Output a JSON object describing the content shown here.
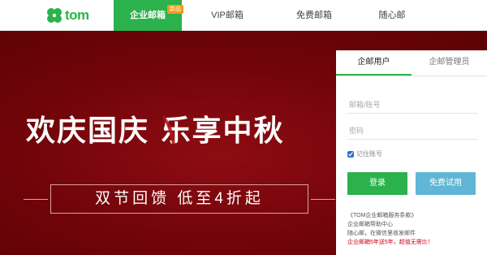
{
  "brand": {
    "logo_text": "tom",
    "logo_color": "#2bb24c"
  },
  "nav": {
    "items": [
      {
        "label": "企业邮箱",
        "active": true,
        "badge": "新品"
      },
      {
        "label": "VIP邮箱"
      },
      {
        "label": "免费邮箱"
      },
      {
        "label": "随心邮"
      }
    ]
  },
  "hero": {
    "line1": "欢庆国庆 乐享中秋",
    "line2": "双节回馈 低至4折起",
    "background": "#7a070c"
  },
  "login": {
    "tabs": [
      {
        "label": "企邮用户",
        "active": true
      },
      {
        "label": "企邮管理员"
      }
    ],
    "username_placeholder": "邮箱/账号",
    "password_placeholder": "密码",
    "remember_label": "记住账号",
    "remember_checked": true,
    "login_button": "登录",
    "trial_button": "免费试用",
    "links": [
      "《TOM企业邮箱服务条款》",
      "企业邮箱帮助中心",
      "随心邮，在微信里收发邮件"
    ],
    "promo_link": "企业邮箱5年送5年，超值无需比！"
  },
  "colors": {
    "accent_green": "#2bb24c",
    "trial_blue": "#5fb6d6",
    "badge_orange": "#f29a1a",
    "promo_red": "#d0021b"
  }
}
